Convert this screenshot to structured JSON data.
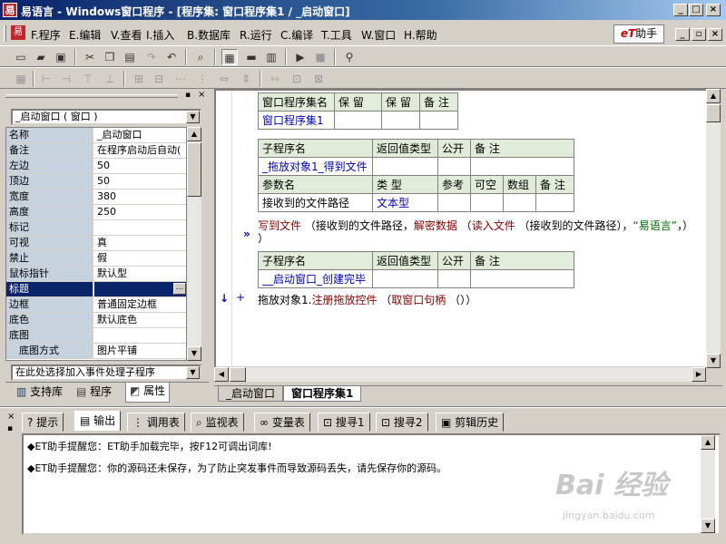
{
  "window": {
    "app_icon": "易",
    "title": "易语言 - Windows窗口程序 - [程序集: 窗口程序集1 / _启动窗口]",
    "buttons": [
      "_",
      "□",
      "×"
    ]
  },
  "menu": {
    "items": [
      "F.程序",
      "E.编辑",
      "V.查看",
      "I.插入",
      "B.数据库",
      "R.运行",
      "C.编译",
      "T.工具",
      "W.窗口",
      "H.帮助"
    ],
    "et_logo": "eT",
    "et_label": "助手",
    "mdi_buttons": [
      "_",
      "▫",
      "×"
    ]
  },
  "left_panel": {
    "object_combo": "_启动窗口 ( 窗口 )",
    "properties": [
      {
        "name": "名称",
        "value": "_启动窗口"
      },
      {
        "name": "备注",
        "value": "在程序启动后自动("
      },
      {
        "name": "左边",
        "value": "50"
      },
      {
        "name": "顶边",
        "value": "50"
      },
      {
        "name": "宽度",
        "value": "380"
      },
      {
        "name": "高度",
        "value": "250"
      },
      {
        "name": "标记",
        "value": ""
      },
      {
        "name": "可视",
        "value": "真"
      },
      {
        "name": "禁止",
        "value": "假"
      },
      {
        "name": "鼠标指针",
        "value": "默认型"
      },
      {
        "name": "标题",
        "value": ""
      },
      {
        "name": "边框",
        "value": "普通固定边框"
      },
      {
        "name": "底色",
        "value": "默认底色"
      },
      {
        "name": "底图",
        "value": ""
      },
      {
        "name": "底图方式",
        "value": "图片平铺"
      }
    ],
    "ellipsis": "...",
    "event_combo": "在此处选择加入事件处理子程序",
    "tabs": [
      "支持库",
      "程序",
      "属性"
    ]
  },
  "editor": {
    "assembly_table": {
      "headers": [
        "窗口程序集名",
        "保 留",
        "保 留",
        "备 注"
      ],
      "row": [
        "窗口程序集1",
        "",
        "",
        ""
      ]
    },
    "sub1": {
      "headers": [
        "子程序名",
        "返回值类型",
        "公开",
        "备 注"
      ],
      "name": "_拖放对象1_得到文件",
      "param_headers": [
        "参数名",
        "类 型",
        "参考",
        "可空",
        "数组",
        "备 注"
      ],
      "param": [
        "接收到的文件路径",
        "文本型",
        "",
        "",
        "",
        ""
      ]
    },
    "code_line1": {
      "fn": "写到文件",
      "open": " （接收到的文件路径，",
      "fn2": "解密数据",
      "mid": " （",
      "fn3": "读入文件",
      "mid2": " （接收到的文件路径），",
      "str": "“易语言”",
      "close": "，）"
    },
    "code_line1_wrap": "）",
    "wrap_mark": "»",
    "sub2": {
      "headers": [
        "子程序名",
        "返回值类型",
        "公开",
        "备 注"
      ],
      "name": "__启动窗口_创建完毕"
    },
    "code_line2": {
      "arrow": "↓",
      "plus": "+",
      "obj": "拖放对象1.",
      "fn": "注册拖放控件",
      "open": " （",
      "fn2": "取窗口句柄",
      "close": " （））"
    },
    "tabs": [
      "_启动窗口",
      "窗口程序集1"
    ]
  },
  "bottom": {
    "tabs": [
      "提示",
      "输出",
      "调用表",
      "监视表",
      "变量表",
      "搜寻1",
      "搜寻2",
      "剪辑历史"
    ],
    "output_lines": [
      "◆ET助手提醒您：ET助手加载完毕，按F12可调出词库!",
      "◆ET助手提醒您：你的源码还未保存，为了防止突发事件而导致源码丢失，请先保存你的源码。"
    ],
    "watermark": "Bai 经验",
    "watermark_sub": "jingyan.baidu.com"
  },
  "colors": {
    "title_bar": "#0a246a",
    "selected_row": "#0a246a",
    "table_header": "#e0ecd8",
    "keyword_blue": "#0000c0",
    "command_red": "#8b0000",
    "string_green": "#007000"
  }
}
